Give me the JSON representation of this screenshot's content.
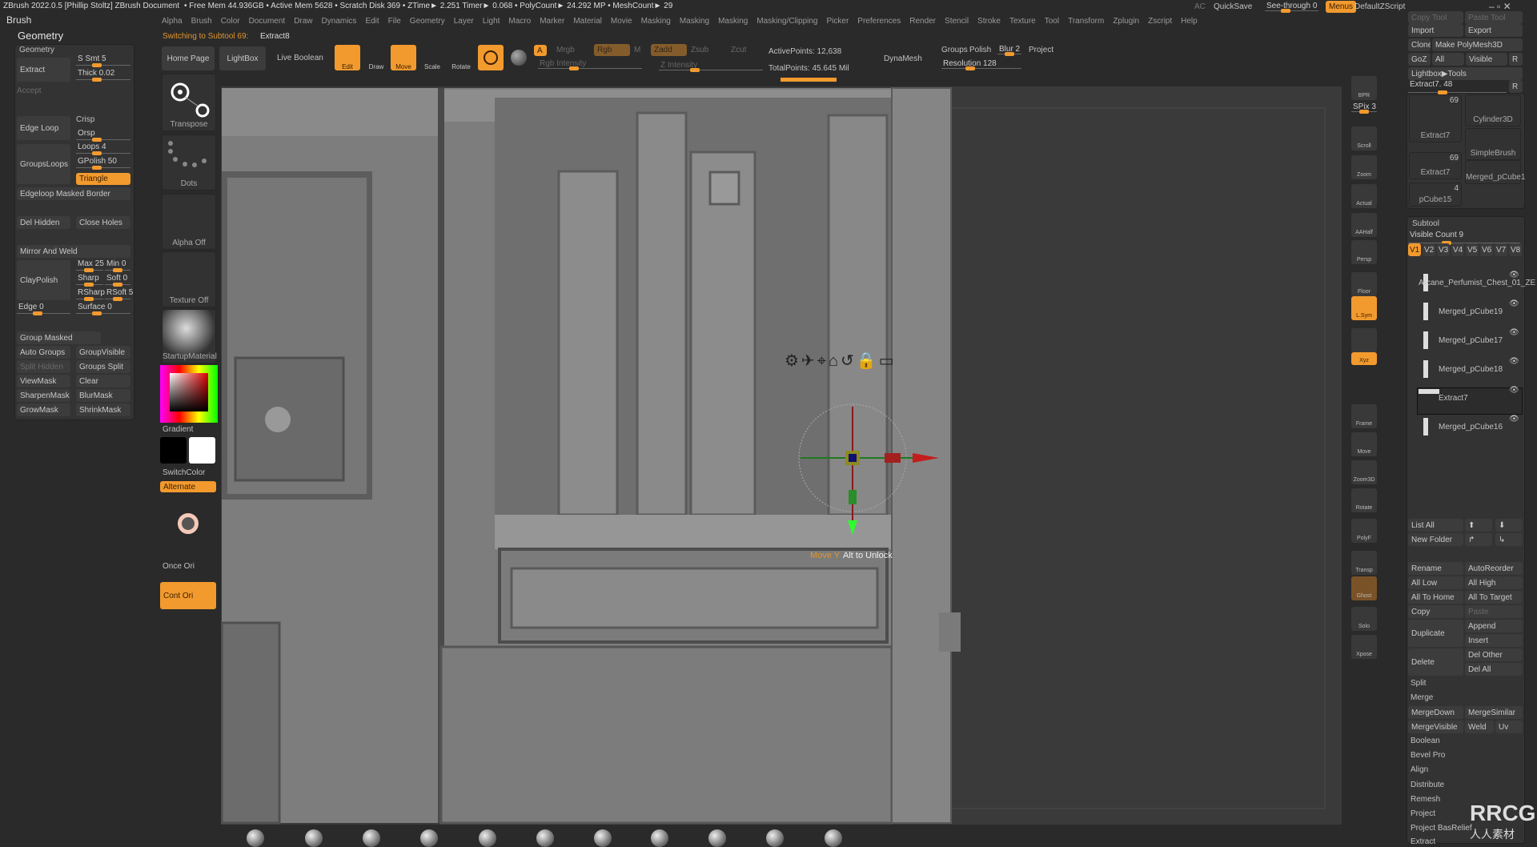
{
  "titlebar": {
    "title": "ZBrush 2022.0.5 [Phillip Stoltz]   ZBrush Document",
    "stats": "• Free Mem 44.936GB • Active Mem 5628 • Scratch Disk 369 •  ZTime► 2.251 Timer► 0.068 • PolyCount► 24.292 MP  • MeshCount► 29",
    "ac": "AC",
    "quicksave": "QuickSave",
    "see_through": "See-through  0",
    "menus": "Menus",
    "default_zscript": "DefaultZScript"
  },
  "menu": [
    "Alpha",
    "Brush",
    "Color",
    "Document",
    "Draw",
    "Dynamics",
    "Edit",
    "File",
    "Geometry",
    "Layer",
    "Light",
    "Macro",
    "Marker",
    "Material",
    "Movie",
    "Masking",
    "Masking",
    "Masking",
    "Masking/Clipping",
    "Picker",
    "Preferences",
    "Render",
    "Stencil",
    "Stroke",
    "Texture",
    "Tool",
    "Transform",
    "Zplugin",
    "Zscript",
    "Help"
  ],
  "notice": {
    "prefix": "Switching to Subtool 69:",
    "value": "Extract8"
  },
  "left": {
    "brush": "Brush",
    "geometry": "Geometry",
    "panel_title": "Geometry",
    "extract": "Extract",
    "ssmt": "S Smt 5",
    "thick": "Thick 0.02",
    "accept": "Accept",
    "edge_loop": "Edge Loop",
    "crisp": "Crisp",
    "orsp": "Orsp",
    "groups_loops": "GroupsLoops",
    "loops": "Loops 4",
    "gpolish": "GPolish 50",
    "triangle": "Triangle",
    "edgeloop_masked": "Edgeloop Masked Border",
    "del_hidden": "Del Hidden",
    "close_holes": "Close Holes",
    "mirror_weld": "Mirror And Weld",
    "claypolish": "ClayPolish",
    "max": "Max 25",
    "min": "Min 0",
    "sharp": "Sharp",
    "soft": "Soft 0",
    "rsharp": "RSharp",
    "rsoft": "RSoft 5",
    "edge": "Edge 0",
    "surface": "Surface 0",
    "group_masked": "Group Masked",
    "auto_groups": "Auto Groups",
    "group_visible": "GroupVisible",
    "split_hidden": "Split Hidden",
    "groups_split": "Groups Split",
    "viewmask": "ViewMask",
    "clear": "Clear",
    "sharpenmask": "SharpenMask",
    "blurmask": "BlurMask",
    "growmask": "GrowMask",
    "shrinkmask": "ShrinkMask"
  },
  "shelf": {
    "home_page": "Home Page",
    "lightbox": "LightBox",
    "live_boolean": "Live Boolean",
    "transpose": "Transpose",
    "dots": "Dots",
    "alpha_off": "Alpha Off",
    "texture_off": "Texture Off",
    "material": "StartupMaterial",
    "gradient": "Gradient",
    "switch_color": "SwitchColor",
    "alternate": "Alternate",
    "once_ori": "Once Ori",
    "cont_ori": "Cont Ori"
  },
  "toolbar": {
    "edit": "Edit",
    "draw": "Draw",
    "move": "Move",
    "scale": "Scale",
    "rotate": "Rotate",
    "a": "A",
    "mrgb": "Mrgb",
    "rgb": "Rgb",
    "m": "M",
    "rgb_intensity": "Rgb Intensity",
    "zadd": "Zadd",
    "zsub": "Zsub",
    "zcut": "Zcut",
    "z_intensity": "Z Intensity",
    "active_points": "ActivePoints: 12,638",
    "total_points": "TotalPoints: 45.645 Mil",
    "dynamesh": "DynaMesh",
    "groups": "Groups",
    "polish": "Polish",
    "blur": "Blur 2",
    "project": "Project",
    "resolution": "Resolution 128"
  },
  "rshelf": [
    "BPR",
    "SPix 3",
    "Scroll",
    "Zoom",
    "Actual",
    "AAHalf",
    "Persp",
    "Floor",
    "L.Sym",
    "",
    "Xyz",
    "Frame",
    "Move",
    "Zoom3D",
    "Rotate",
    "PolyF",
    "Transp",
    "Ghost",
    "Solo",
    "Xpose"
  ],
  "right": {
    "copy_tool": "Copy Tool",
    "paste_tool": "Paste Tool",
    "import": "Import",
    "export": "Export",
    "clone": "Clone",
    "make_polymesh": "Make PolyMesh3D",
    "goz": "GoZ",
    "all": "All",
    "visible": "Visible",
    "r": "R",
    "lightbox_tools": "Lightbox▶Tools",
    "current_tool": "Extract7. 48",
    "thumbs": [
      {
        "name": "Extract7",
        "count": "69"
      },
      {
        "name": "Cylinder3D"
      },
      {
        "name": "SimpleBrush"
      },
      {
        "name": "Extract7",
        "count": "69"
      },
      {
        "name": "Merged_pCube1"
      },
      {
        "name": "pCube15",
        "count": "4"
      }
    ],
    "subtool_title": "Subtool",
    "visible_count": "Visible Count 9",
    "versions": [
      "V1",
      "V2",
      "V3",
      "V4",
      "V5",
      "V6",
      "V7",
      "V8"
    ],
    "subtools": [
      "Arcane_Perfumist_Chest_01_ZE",
      "Merged_pCube19",
      "Merged_pCube17",
      "Merged_pCube18",
      "Extract7",
      "Merged_pCube16"
    ],
    "list_all": "List All",
    "new_folder": "New Folder",
    "rename": "Rename",
    "auto_reorder": "AutoReorder",
    "all_low": "All Low",
    "all_high": "All High",
    "all_to_home": "All To Home",
    "all_to_target": "All To Target",
    "copy": "Copy",
    "paste": "Paste",
    "duplicate": "Duplicate",
    "append": "Append",
    "insert": "Insert",
    "delete": "Delete",
    "del_other": "Del Other",
    "del_all": "Del All",
    "split": "Split",
    "merge": "Merge",
    "merge_down": "MergeDown",
    "merge_similar": "MergeSimilar",
    "merge_visible": "MergeVisible",
    "weld": "Weld",
    "uv": "Uv",
    "boolean": "Boolean",
    "bevel_pro": "Bevel Pro",
    "align": "Align",
    "distribute": "Distribute",
    "remesh": "Remesh",
    "project": "Project",
    "project_basrelief": "Project BasRelief",
    "extract": "Extract"
  },
  "viewport": {
    "gizmo_action": "Move Y",
    "gizmo_hint": "Alt to Unlock"
  },
  "watermark": {
    "logo": "RRCG",
    "sub": "人人素材"
  },
  "colors": {
    "accent": "#f29a2e",
    "bg": "#2a2a2a",
    "panel": "#333333",
    "model": "#808080"
  }
}
